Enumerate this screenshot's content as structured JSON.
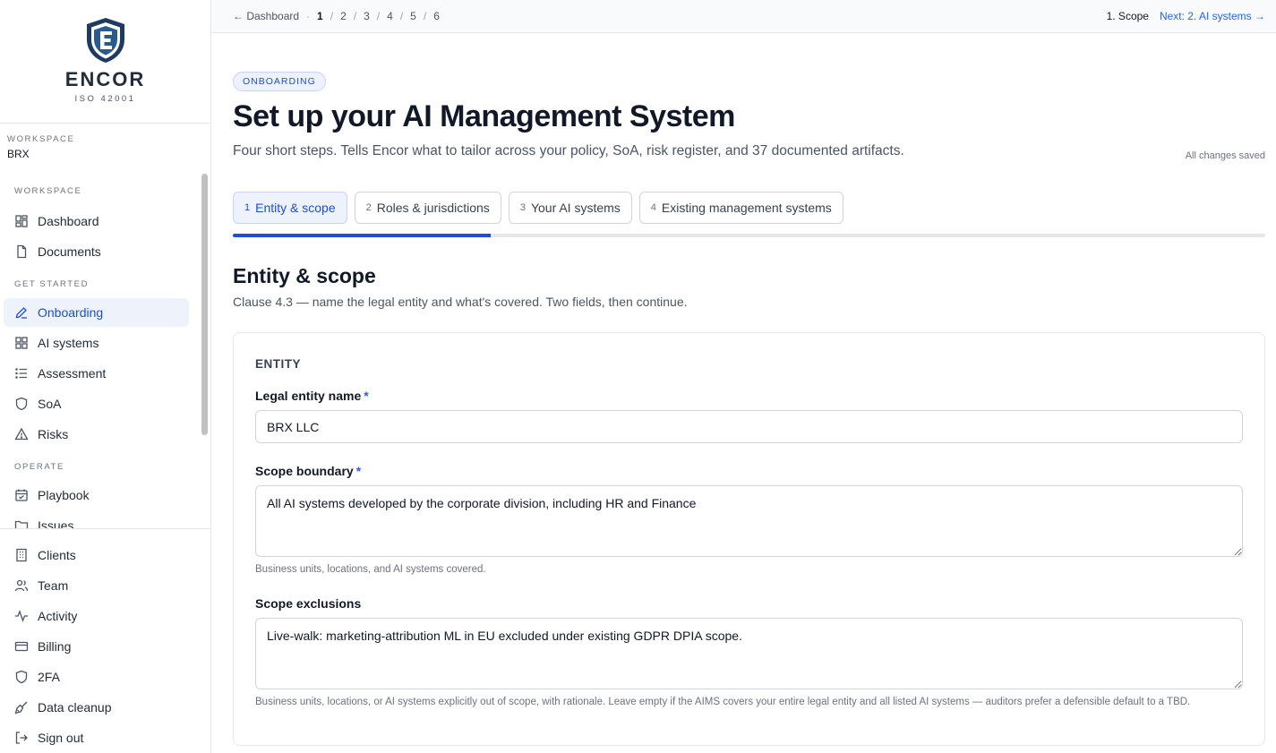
{
  "brand": {
    "name": "ENCOR",
    "subtitle": "ISO 42001"
  },
  "workspace": {
    "caption": "WORKSPACE",
    "value": "BRX"
  },
  "sidebar": {
    "sections": [
      {
        "title": "WORKSPACE",
        "items": [
          {
            "label": "Dashboard",
            "icon": "dashboard-icon"
          },
          {
            "label": "Documents",
            "icon": "document-icon"
          }
        ]
      },
      {
        "title": "GET STARTED",
        "items": [
          {
            "label": "Onboarding",
            "icon": "pen-icon",
            "active": true
          },
          {
            "label": "AI systems",
            "icon": "grid-icon"
          },
          {
            "label": "Assessment",
            "icon": "list-icon"
          },
          {
            "label": "SoA",
            "icon": "shield-icon"
          },
          {
            "label": "Risks",
            "icon": "warning-icon"
          }
        ]
      },
      {
        "title": "OPERATE",
        "items": [
          {
            "label": "Playbook",
            "icon": "calendar-check-icon"
          },
          {
            "label": "Issues",
            "icon": "folder-icon"
          }
        ]
      }
    ],
    "bottom": [
      {
        "label": "Clients",
        "icon": "building-icon"
      },
      {
        "label": "Team",
        "icon": "users-icon"
      },
      {
        "label": "Activity",
        "icon": "activity-icon"
      },
      {
        "label": "Billing",
        "icon": "card-icon"
      },
      {
        "label": "2FA",
        "icon": "shield-icon"
      },
      {
        "label": "Data cleanup",
        "icon": "broom-icon"
      },
      {
        "label": "Sign out",
        "icon": "signout-icon"
      }
    ]
  },
  "topbar": {
    "back": "← Dashboard",
    "dot": "·",
    "steps": [
      "1",
      "2",
      "3",
      "4",
      "5",
      "6"
    ],
    "current_step": "1. Scope",
    "next": "Next: 2. AI systems →"
  },
  "header": {
    "badge": "ONBOARDING",
    "title": "Set up your AI Management System",
    "subtitle": "Four short steps. Tells Encor what to tailor across your policy, SoA, risk register, and 37 documented artifacts.",
    "saved": "All changes saved"
  },
  "tabs": [
    {
      "num": "1",
      "label": "Entity & scope",
      "active": true
    },
    {
      "num": "2",
      "label": "Roles & jurisdictions"
    },
    {
      "num": "3",
      "label": "Your AI systems"
    },
    {
      "num": "4",
      "label": "Existing management systems"
    }
  ],
  "progress": 0.25,
  "section": {
    "title": "Entity & scope",
    "subtitle": "Clause 4.3 — name the legal entity and what's covered. Two fields, then continue."
  },
  "form": {
    "card_title": "ENTITY",
    "legal_entity": {
      "label": "Legal entity name",
      "required": "*",
      "value": "BRX LLC"
    },
    "scope_boundary": {
      "label": "Scope boundary",
      "required": "*",
      "value": "All AI systems developed by the corporate division, including HR and Finance",
      "help": "Business units, locations, and AI systems covered."
    },
    "scope_exclusions": {
      "label": "Scope exclusions",
      "value": "Live-walk: marketing-attribution ML in EU excluded under existing GDPR DPIA scope.",
      "help": "Business units, locations, or AI systems explicitly out of scope, with rationale. Leave empty if the AIMS covers your entire legal entity and all listed AI systems — auditors prefer a defensible default to a TBD."
    }
  },
  "colors": {
    "accent": "#1d4ed8",
    "link": "#2563eb",
    "border": "#e5e7eb"
  }
}
